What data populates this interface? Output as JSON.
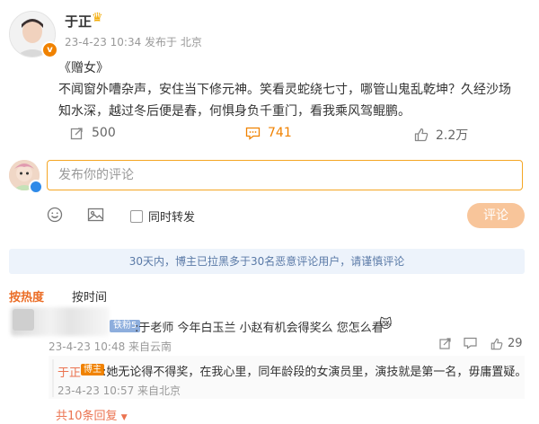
{
  "author": {
    "name": "于正",
    "meta": "23-4-23 10:34  发布于 北京"
  },
  "post": {
    "title": "《赠女》",
    "line1": "不闻窗外嘈杂声，安住当下修元神。笑看灵蛇绕七寸，哪管山鬼乱乾坤？久经沙场",
    "line2": "知水深，越过冬后便是春，何惧身负千重门，看我乘风驾鲲鹏。"
  },
  "stats": {
    "reposts": "500",
    "comments": "741",
    "likes": "2.2万"
  },
  "composer": {
    "placeholder": "发布你的评论",
    "repost_label": "同时转发",
    "submit_label": "评论"
  },
  "notice": "30天内，博主已拉黑多于30名恶意评论用户，请谨慎评论",
  "sort": {
    "hot": "按热度",
    "time": "按时间"
  },
  "comment": {
    "badge": "铁粉5",
    "text": ":于老师 今年白玉兰 小赵有机会得奖么 您怎么看",
    "emoji": "😿",
    "meta": "23-4-23 10:48  来自云南",
    "likes": "29"
  },
  "reply": {
    "name": "于正",
    "badge": "博主",
    "text": ":她无论得不得奖，在我心里，同年龄段的女演员里，演技就是第一名，毋庸置疑。",
    "meta": "23-4-23 10:57  来自北京"
  },
  "more_replies": "共10条回复",
  "colors": {
    "accent": "#f08200",
    "link": "#eb7350",
    "notice_bg": "#edf3fb"
  }
}
